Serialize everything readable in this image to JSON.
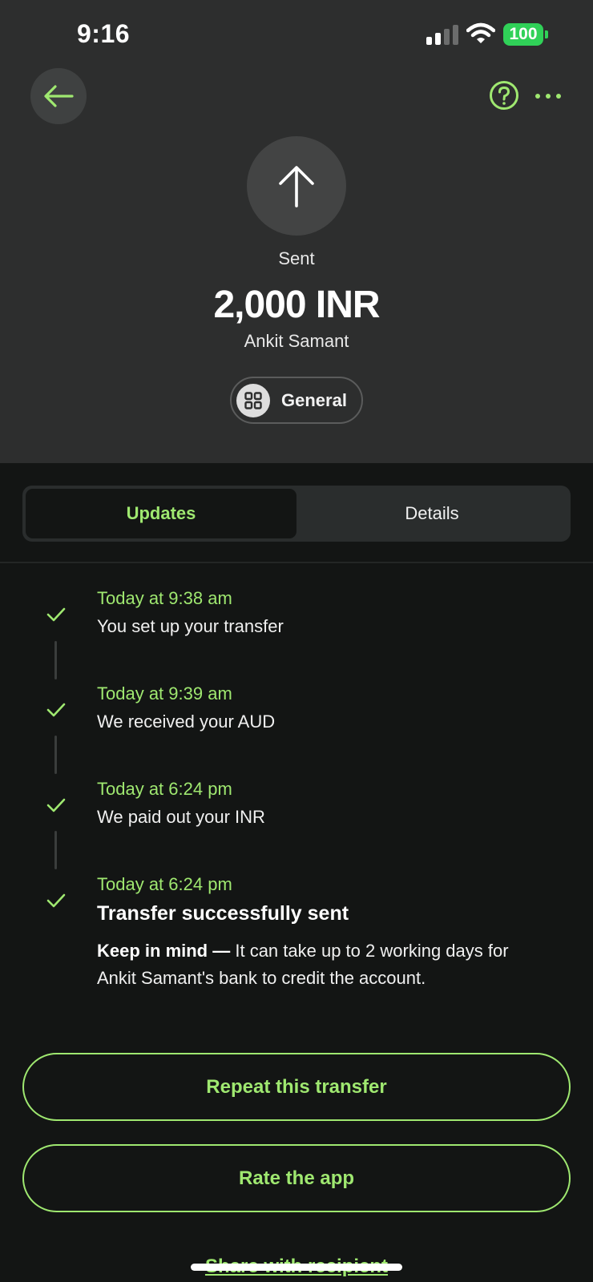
{
  "status_bar": {
    "time": "9:16",
    "battery": "100"
  },
  "header": {
    "status_label": "Sent",
    "amount": "2,000 INR",
    "recipient": "Ankit Samant",
    "category": "General"
  },
  "tabs": [
    {
      "label": "Updates",
      "active": true
    },
    {
      "label": "Details",
      "active": false
    }
  ],
  "timeline": [
    {
      "time": "Today at 9:38 am",
      "text": "You set up your transfer"
    },
    {
      "time": "Today at 9:39 am",
      "text": "We received your AUD"
    },
    {
      "time": "Today at 6:24 pm",
      "text": "We paid out your INR"
    },
    {
      "time": "Today at 6:24 pm",
      "text": "Transfer successfully sent"
    }
  ],
  "note": {
    "lead": "Keep in mind —",
    "body": " It can take up to 2 working days for Ankit Samant's bank to credit the account."
  },
  "actions": {
    "repeat": "Repeat this transfer",
    "rate": "Rate the app",
    "share": "Share with recipient"
  },
  "colors": {
    "accent": "#9fe870",
    "top_bg": "#2d2e2e",
    "body_bg": "#131514",
    "battery": "#30d158"
  }
}
